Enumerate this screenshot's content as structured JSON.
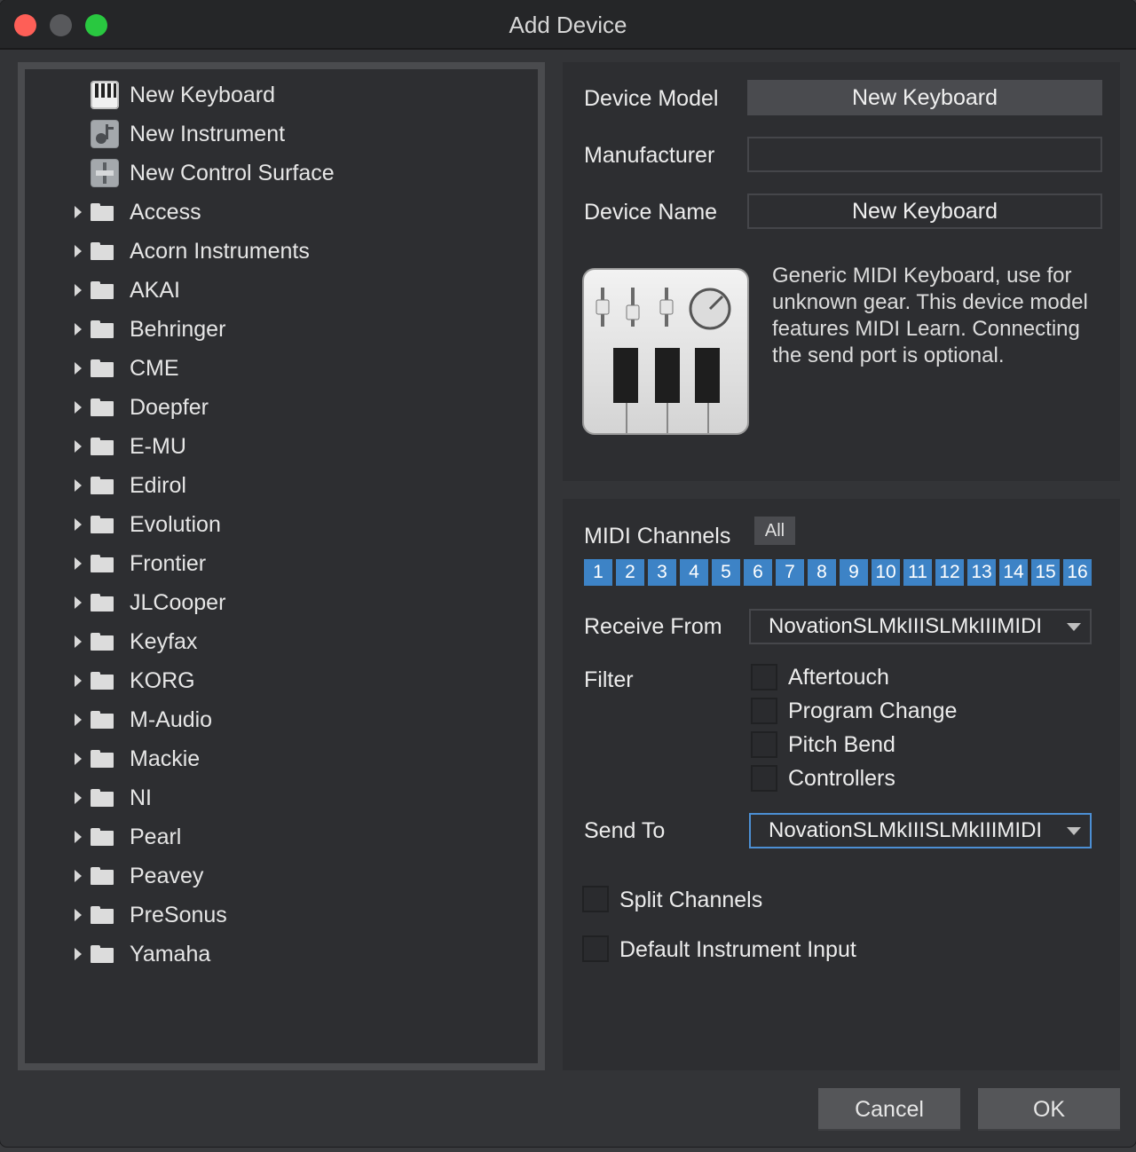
{
  "window": {
    "title": "Add Device"
  },
  "tree": {
    "devices": [
      {
        "label": "New Keyboard",
        "icon": "keyboard-icon"
      },
      {
        "label": "New Instrument",
        "icon": "instrument-icon"
      },
      {
        "label": "New Control Surface",
        "icon": "control-surface-icon"
      }
    ],
    "folders": [
      "Access",
      "Acorn Instruments",
      "AKAI",
      "Behringer",
      "CME",
      "Doepfer",
      "E-MU",
      "Edirol",
      "Evolution",
      "Frontier",
      "JLCooper",
      "Keyfax",
      "KORG",
      "M-Audio",
      "Mackie",
      "NI",
      "Pearl",
      "Peavey",
      "PreSonus",
      "Yamaha"
    ]
  },
  "details": {
    "device_model_label": "Device Model",
    "device_model_value": "New Keyboard",
    "manufacturer_label": "Manufacturer",
    "manufacturer_value": "",
    "device_name_label": "Device Name",
    "device_name_value": "New Keyboard",
    "description": "Generic MIDI Keyboard, use for unknown gear. This device model features MIDI Learn. Connecting the send port is optional."
  },
  "midi": {
    "channels_label": "MIDI Channels",
    "all_label": "All",
    "channels": [
      "1",
      "2",
      "3",
      "4",
      "5",
      "6",
      "7",
      "8",
      "9",
      "10",
      "11",
      "12",
      "13",
      "14",
      "15",
      "16"
    ],
    "accent_color": "#3d83c6",
    "receive_from_label": "Receive From",
    "receive_from_value": "NovationSLMkIIISLMkIIIMIDI",
    "filter_label": "Filter",
    "filters": [
      "Aftertouch",
      "Program Change",
      "Pitch Bend",
      "Controllers"
    ],
    "send_to_label": "Send To",
    "send_to_value": "NovationSLMkIIISLMkIIIMIDI",
    "split_channels_label": "Split Channels",
    "default_input_label": "Default Instrument Input"
  },
  "buttons": {
    "cancel": "Cancel",
    "ok": "OK"
  }
}
